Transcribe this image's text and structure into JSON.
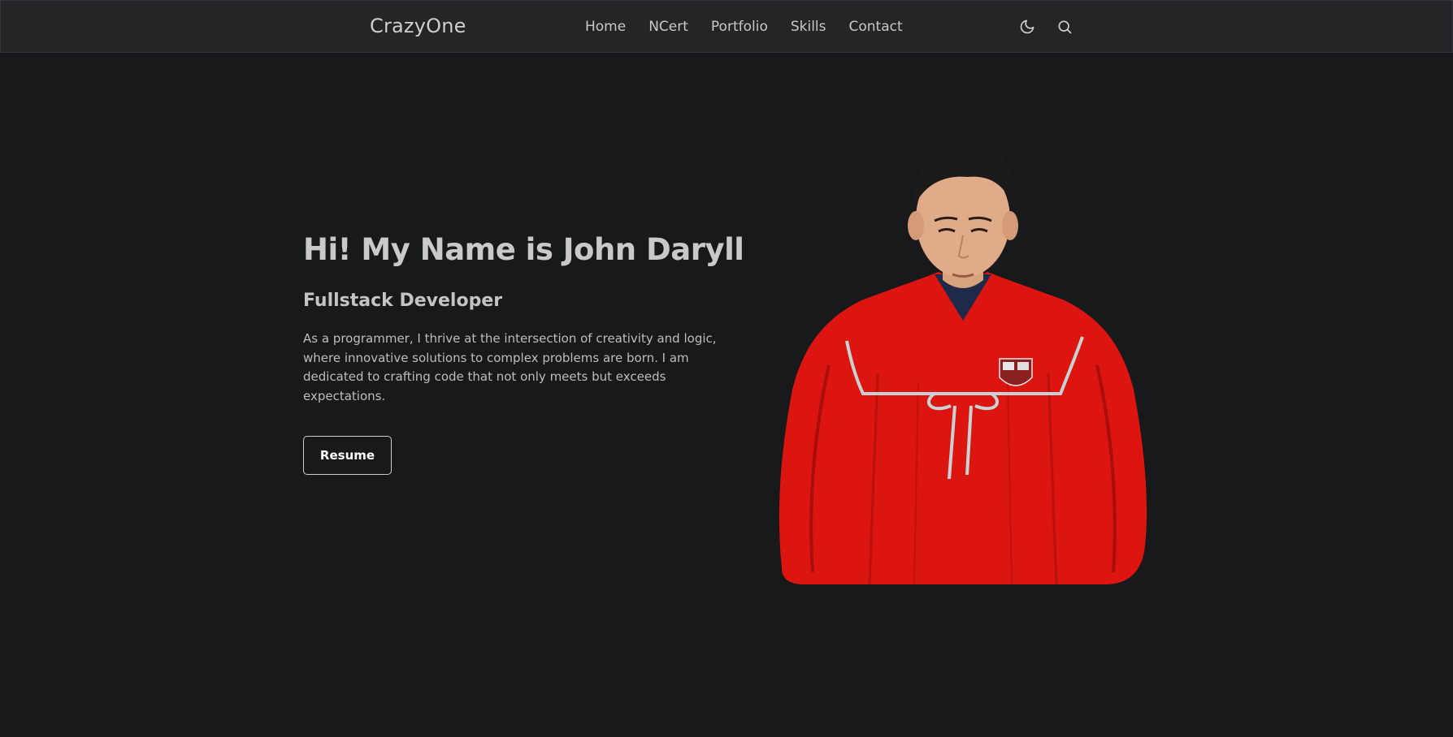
{
  "header": {
    "logo": "CrazyOne",
    "nav": [
      {
        "label": "Home"
      },
      {
        "label": "NCert"
      },
      {
        "label": "Portfolio"
      },
      {
        "label": "Skills"
      },
      {
        "label": "Contact"
      }
    ],
    "icons": {
      "theme_toggle": "moon-icon",
      "search": "search-icon"
    }
  },
  "hero": {
    "title": "Hi! My Name is John Daryll",
    "subtitle": "Fullstack Developer",
    "description": "As a programmer, I thrive at the intersection of creativity and logic, where innovative solutions to complex problems are born. I am dedicated to crafting code that not only meets but exceeds expectations.",
    "resume_label": "Resume",
    "portrait_alt": "John Daryll in red graduation gown"
  },
  "colors": {
    "background": "#18191b",
    "header_background": "#242527",
    "gown_red": "#e01610",
    "text_primary": "#c9c9c9"
  }
}
